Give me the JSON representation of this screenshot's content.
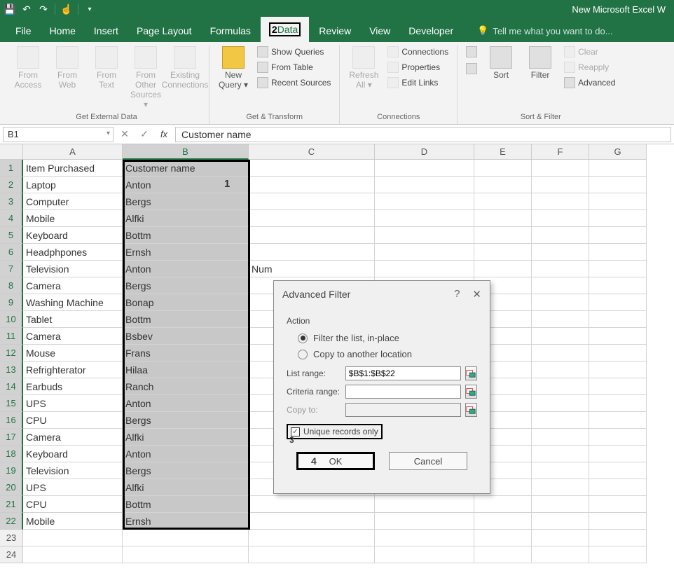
{
  "titlebar": {
    "title": "New Microsoft Excel W"
  },
  "tabs": {
    "file": "File",
    "home": "Home",
    "insert": "Insert",
    "pagelayout": "Page Layout",
    "formulas": "Formulas",
    "data": "Data",
    "review": "Review",
    "view": "View",
    "developer": "Developer",
    "tellme": "Tell me what you want to do..."
  },
  "annotations": {
    "tab": "2",
    "cell": "1",
    "chk": "3",
    "ok": "4"
  },
  "ribbon": {
    "external": {
      "access": "From Access",
      "web": "From Web",
      "text": "From Text",
      "other": "From Other Sources ▾",
      "existing": "Existing Connections",
      "label": "Get External Data"
    },
    "transform": {
      "newq": "New Query ▾",
      "showq": "Show Queries",
      "fromtbl": "From Table",
      "recent": "Recent Sources",
      "label": "Get & Transform"
    },
    "conn": {
      "refresh": "Refresh All ▾",
      "conn": "Connections",
      "prop": "Properties",
      "edit": "Edit Links",
      "label": "Connections"
    },
    "sort": {
      "sort": "Sort",
      "filter": "Filter",
      "clear": "Clear",
      "reapply": "Reapply",
      "adv": "Advanced",
      "label": "Sort & Filter"
    }
  },
  "formula": {
    "namebox": "B1",
    "content": "Customer name"
  },
  "cols": [
    "A",
    "B",
    "C",
    "D",
    "E",
    "F",
    "G"
  ],
  "rows": [
    {
      "n": 1,
      "a": "Item Purchased",
      "b": "Customer name"
    },
    {
      "n": 2,
      "a": "Laptop",
      "b": "Anton"
    },
    {
      "n": 3,
      "a": "Computer",
      "b": "Bergs"
    },
    {
      "n": 4,
      "a": "Mobile",
      "b": "Alfki"
    },
    {
      "n": 5,
      "a": "Keyboard",
      "b": "Bottm"
    },
    {
      "n": 6,
      "a": "Headphpones",
      "b": "Ernsh"
    },
    {
      "n": 7,
      "a": "Television",
      "b": "Anton",
      "c": "Num"
    },
    {
      "n": 8,
      "a": "Camera",
      "b": "Bergs"
    },
    {
      "n": 9,
      "a": "Washing Machine",
      "b": "Bonap"
    },
    {
      "n": 10,
      "a": "Tablet",
      "b": "Bottm"
    },
    {
      "n": 11,
      "a": "Camera",
      "b": "Bsbev"
    },
    {
      "n": 12,
      "a": "Mouse",
      "b": "Frans"
    },
    {
      "n": 13,
      "a": "Refrighterator",
      "b": "Hilaa"
    },
    {
      "n": 14,
      "a": "Earbuds",
      "b": "Ranch"
    },
    {
      "n": 15,
      "a": "UPS",
      "b": "Anton"
    },
    {
      "n": 16,
      "a": "CPU",
      "b": "Bergs"
    },
    {
      "n": 17,
      "a": "Camera",
      "b": "Alfki"
    },
    {
      "n": 18,
      "a": "Keyboard",
      "b": "Anton"
    },
    {
      "n": 19,
      "a": "Television",
      "b": "Bergs"
    },
    {
      "n": 20,
      "a": "UPS",
      "b": "Alfki"
    },
    {
      "n": 21,
      "a": "CPU",
      "b": "Bottm"
    },
    {
      "n": 22,
      "a": "Mobile",
      "b": "Ernsh"
    },
    {
      "n": 23,
      "a": "",
      "b": ""
    },
    {
      "n": 24,
      "a": "",
      "b": ""
    }
  ],
  "dialog": {
    "title": "Advanced Filter",
    "action_label": "Action",
    "opt_inplace": "Filter the list, in-place",
    "opt_copy": "Copy to another location",
    "list_range_lbl": "List range:",
    "list_range_val": "$B$1:$B$22",
    "crit_range_lbl": "Criteria range:",
    "crit_range_val": "",
    "copyto_lbl": "Copy to:",
    "copyto_val": "",
    "unique": "Unique records only",
    "ok": "OK",
    "cancel": "Cancel"
  }
}
